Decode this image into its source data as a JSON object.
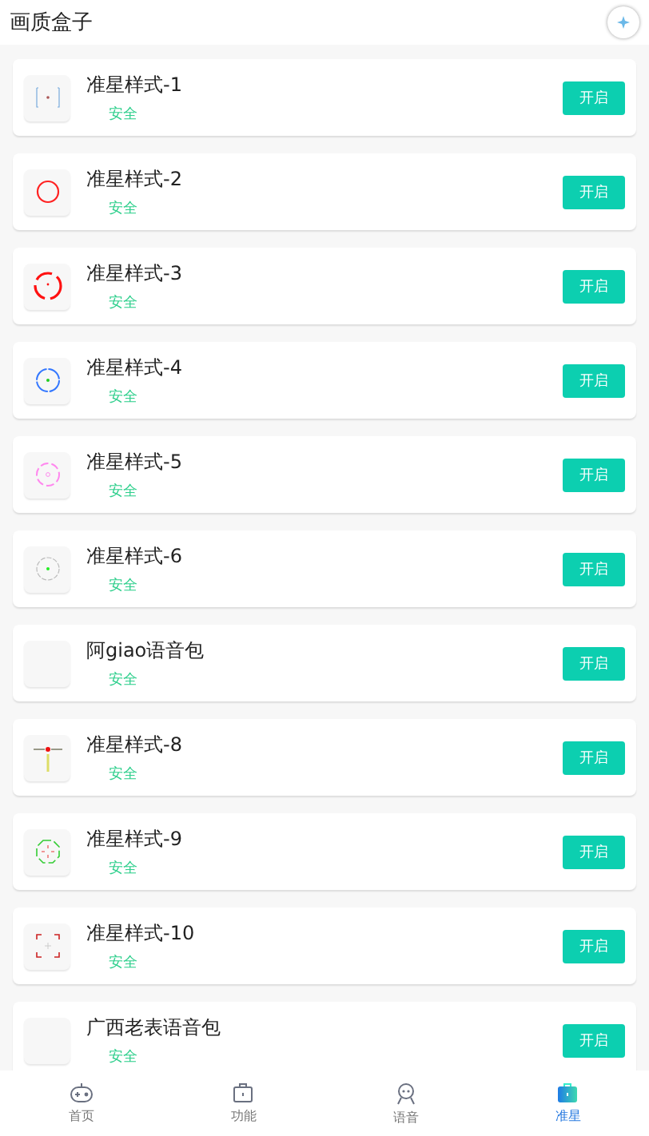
{
  "header": {
    "title": "画质盒子"
  },
  "items": [
    {
      "name": "准星样式-1",
      "tag": "安全",
      "button": "开启"
    },
    {
      "name": "准星样式-2",
      "tag": "安全",
      "button": "开启"
    },
    {
      "name": "准星样式-3",
      "tag": "安全",
      "button": "开启"
    },
    {
      "name": "准星样式-4",
      "tag": "安全",
      "button": "开启"
    },
    {
      "name": "准星样式-5",
      "tag": "安全",
      "button": "开启"
    },
    {
      "name": "准星样式-6",
      "tag": "安全",
      "button": "开启"
    },
    {
      "name": "阿giao语音包",
      "tag": "安全",
      "button": "开启"
    },
    {
      "name": "准星样式-8",
      "tag": "安全",
      "button": "开启"
    },
    {
      "name": "准星样式-9",
      "tag": "安全",
      "button": "开启"
    },
    {
      "name": "准星样式-10",
      "tag": "安全",
      "button": "开启"
    },
    {
      "name": "广西老表语音包",
      "tag": "安全",
      "button": "开启"
    }
  ],
  "tabs": [
    {
      "label": "首页",
      "selected": false
    },
    {
      "label": "功能",
      "selected": false
    },
    {
      "label": "语音",
      "selected": false
    },
    {
      "label": "准星",
      "selected": true
    }
  ]
}
